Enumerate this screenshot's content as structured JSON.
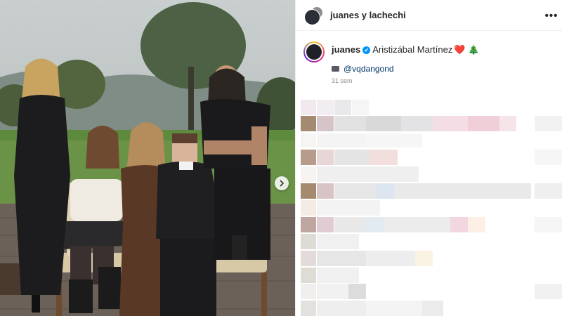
{
  "header": {
    "title": "juanes y lachechi"
  },
  "post": {
    "username": "juanes",
    "verified_mark": "✔",
    "caption_text": "Aristizábal Martínez",
    "caption_emojis": "❤️ 🎄",
    "photo_credit_mention": "@vqdangond",
    "timestamp": "31 sem"
  },
  "icons": {
    "more": "more-options-icon",
    "next": "chevron-right-icon",
    "camera": "camera-icon",
    "verified": "verified-badge-icon"
  },
  "colors": {
    "verified_blue": "#0095f6",
    "mention_blue": "#00376b",
    "text_primary": "#262626",
    "text_secondary": "#8e8e8e"
  }
}
